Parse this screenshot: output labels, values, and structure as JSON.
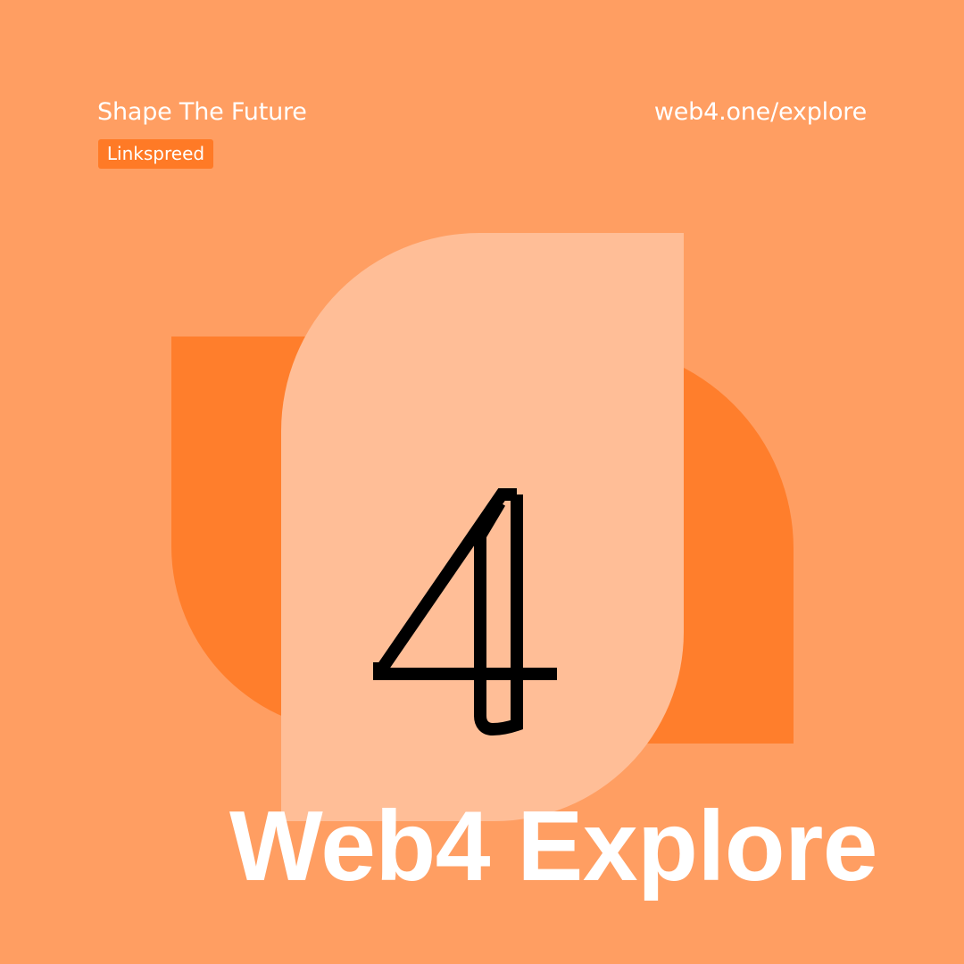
{
  "header": {
    "tagline": "Shape The Future",
    "brand_badge": "Linkspreed",
    "site_url": "web4.one/explore"
  },
  "emblem": {
    "glyph": "4",
    "icon": "web4-logo-icon"
  },
  "headline": "Web4 Explore",
  "colors": {
    "background": "#FF9E62",
    "accent_orange": "#FF7A26",
    "light_shape": "#FFBE97",
    "text": "#FFFFFF",
    "glyph_stroke": "#000000"
  }
}
